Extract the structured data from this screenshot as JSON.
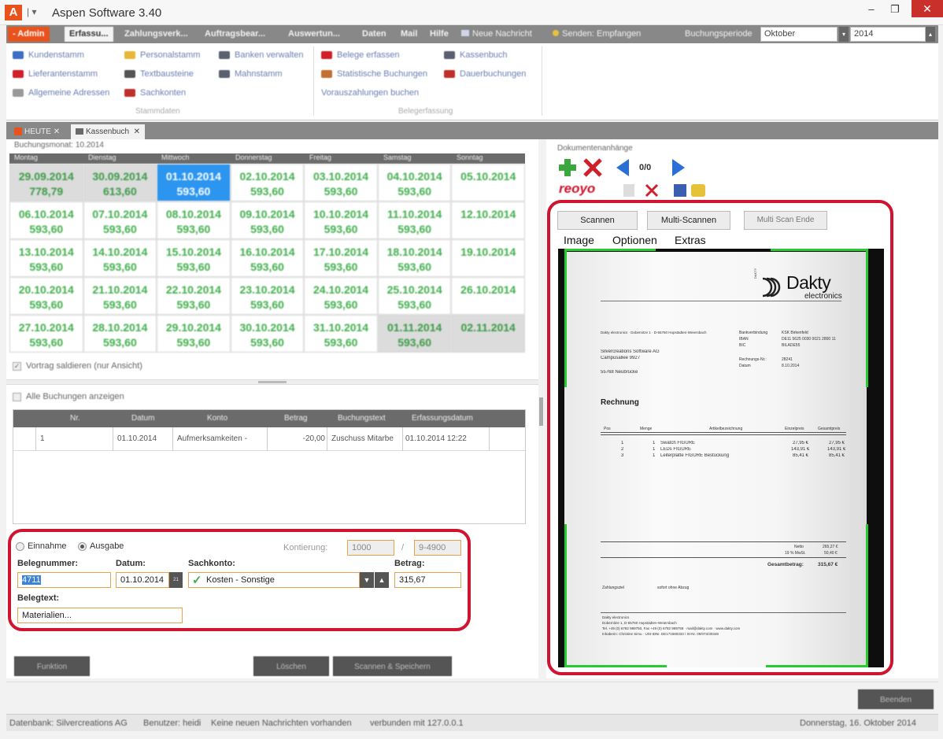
{
  "app": {
    "logo_letter": "A",
    "qat": "|  ▾",
    "title": "Aspen Software 3.40",
    "minimize": "–",
    "restore": "❐",
    "close": "✕"
  },
  "menu": {
    "items": [
      "- Admin",
      "Erfassu...",
      "Zahlungsverk...",
      "Auftragsbear...",
      "Auswertun...",
      "Daten",
      "Mail",
      "Hilfe"
    ],
    "new_message": "Neue Nachricht",
    "send": "Senden: Empfangen",
    "period_label": "Buchungsperiode",
    "month": "Oktober",
    "year": "2014"
  },
  "ribbon": {
    "col1": [
      "Kundenstamm",
      "Lieferantenstamm",
      "Allgemeine Adressen"
    ],
    "col2": [
      "Personalstamm",
      "Textbausteine",
      "Sachkonten"
    ],
    "col3": [
      "Banken verwalten",
      "Mahnstamm"
    ],
    "group1": "Stammdaten",
    "col4": [
      "Belege erfassen",
      "Statistische Buchungen",
      "Vorauszahlungen buchen"
    ],
    "col5": [
      "Kassenbuch",
      "Dauerbuchungen"
    ],
    "group2": "Belegerfassung",
    "icon_colors": [
      "#3a6fc4",
      "#d0202a",
      "#999999",
      "#e6b83a",
      "#555555",
      "#c0302a",
      "#5a6070",
      "#3a5fa0",
      "#d0202a",
      "#c07030",
      "#5a6070",
      "#c0302a"
    ]
  },
  "tabs": {
    "heute": "HEUTE",
    "kassenbuch": "Kassenbuch"
  },
  "calendar": {
    "month_label": "Buchungsmonat: 10.2014",
    "days": [
      "Montag",
      "Dienstag",
      "Mittwoch",
      "Donnerstag",
      "Freitag",
      "Samstag",
      "Sonntag"
    ],
    "cells": [
      {
        "d": "29.09.2014",
        "v": "778,79",
        "s": "gray"
      },
      {
        "d": "30.09.2014",
        "v": "613,60",
        "s": "gray"
      },
      {
        "d": "01.10.2014",
        "v": "593,60",
        "s": "today"
      },
      {
        "d": "02.10.2014",
        "v": "593,60",
        "s": ""
      },
      {
        "d": "03.10.2014",
        "v": "593,60",
        "s": ""
      },
      {
        "d": "04.10.2014",
        "v": "593,60",
        "s": ""
      },
      {
        "d": "05.10.2014",
        "v": "",
        "s": ""
      },
      {
        "d": "06.10.2014",
        "v": "593,60",
        "s": ""
      },
      {
        "d": "07.10.2014",
        "v": "593,60",
        "s": ""
      },
      {
        "d": "08.10.2014",
        "v": "593,60",
        "s": ""
      },
      {
        "d": "09.10.2014",
        "v": "593,60",
        "s": ""
      },
      {
        "d": "10.10.2014",
        "v": "593,60",
        "s": ""
      },
      {
        "d": "11.10.2014",
        "v": "593,60",
        "s": ""
      },
      {
        "d": "12.10.2014",
        "v": "",
        "s": ""
      },
      {
        "d": "13.10.2014",
        "v": "593,60",
        "s": ""
      },
      {
        "d": "14.10.2014",
        "v": "593,60",
        "s": ""
      },
      {
        "d": "15.10.2014",
        "v": "593,60",
        "s": ""
      },
      {
        "d": "16.10.2014",
        "v": "593,60",
        "s": ""
      },
      {
        "d": "17.10.2014",
        "v": "593,60",
        "s": ""
      },
      {
        "d": "18.10.2014",
        "v": "593,60",
        "s": ""
      },
      {
        "d": "19.10.2014",
        "v": "",
        "s": ""
      },
      {
        "d": "20.10.2014",
        "v": "593,60",
        "s": ""
      },
      {
        "d": "21.10.2014",
        "v": "593,60",
        "s": ""
      },
      {
        "d": "22.10.2014",
        "v": "593,60",
        "s": ""
      },
      {
        "d": "23.10.2014",
        "v": "593,60",
        "s": ""
      },
      {
        "d": "24.10.2014",
        "v": "593,60",
        "s": ""
      },
      {
        "d": "25.10.2014",
        "v": "593,60",
        "s": ""
      },
      {
        "d": "26.10.2014",
        "v": "",
        "s": ""
      },
      {
        "d": "27.10.2014",
        "v": "593,60",
        "s": ""
      },
      {
        "d": "28.10.2014",
        "v": "593,60",
        "s": ""
      },
      {
        "d": "29.10.2014",
        "v": "593,60",
        "s": ""
      },
      {
        "d": "30.10.2014",
        "v": "593,60",
        "s": ""
      },
      {
        "d": "31.10.2014",
        "v": "593,60",
        "s": ""
      },
      {
        "d": "01.11.2014",
        "v": "593,60",
        "s": "gray"
      },
      {
        "d": "02.11.2014",
        "v": "",
        "s": "gray"
      }
    ]
  },
  "vortrag": "Vortrag saldieren (nur Ansicht)",
  "alle_buchungen": "Alle Buchungen anzeigen",
  "bookings": {
    "headers": [
      "Nr.",
      "Datum",
      "Konto",
      "Betrag",
      "Buchungstext",
      "Erfassungsdatum"
    ],
    "rows": [
      [
        "1",
        "01.10.2014",
        "Aufmerksamkeiten - ",
        "-20,00",
        "Zuschuss Mitarbe",
        "01.10.2014 12:22"
      ]
    ]
  },
  "form": {
    "einnahme": "Einnahme",
    "ausgabe": "Ausgabe",
    "kontierung_label": "Kontierung:",
    "kontierung_a": "1000",
    "kontierung_sep": "/",
    "kontierung_b": "9-4900",
    "belegnummer_label": "Belegnummer:",
    "belegnummer": "4711",
    "datum_label": "Datum:",
    "datum": "01.10.2014",
    "datum_btn": "21",
    "sachkonto_label": "Sachkonto:",
    "sachkonto": "Kosten - Sonstige",
    "betrag_label": "Betrag:",
    "betrag": "315,67",
    "belegtext_label": "Belegtext:",
    "belegtext": "Materialien..."
  },
  "buttons": {
    "funktion": "Funktion",
    "loeschen": "Löschen",
    "scannen_speichern": "Scannen & Speichern",
    "beenden": "Beenden"
  },
  "attachments": {
    "title": "Dokumentenanhänge",
    "counter": "0/0",
    "brand": "reoyo"
  },
  "scanner": {
    "scannen": "Scannen",
    "multi": "Multi-Scannen",
    "multi_end": "Multi Scan Ende",
    "menu": [
      "Image",
      "Optionen",
      "Extras"
    ]
  },
  "invoice": {
    "brand": "Dakty",
    "brand_sub": "electronics",
    "brand_vert": "DAKTY",
    "sender": "Dakty electronics · Dobernitze 1 · D-55760 Hopstädten-Weiersbach",
    "bank_labels": [
      "Bankverbindung",
      "IBAN",
      "BIC"
    ],
    "bank_values": [
      "KSK Birkenfeld",
      "DE11 5625 0030 0021 2800 11",
      "BILADE55"
    ],
    "recipient": [
      "Silvercreations Software AG",
      "Campusallee 9927",
      "",
      "55768     Neubrücke"
    ],
    "meta_labels": [
      "Rechnungs-Nr.:",
      "Datum"
    ],
    "meta_values": [
      "28241",
      "8.10.2014"
    ],
    "heading": "Rechnung",
    "columns": [
      "Pos",
      "Menge",
      "Artikelbezeichnung",
      "Einzelpreis",
      "Gesamtpreis"
    ],
    "lines": [
      [
        "1",
        "1",
        "Swatch FIGURE",
        "27,95 €",
        "27,95 €"
      ],
      [
        "2",
        "1",
        "LEDs FIGURE",
        "143,91 €",
        "143,91 €"
      ],
      [
        "3",
        "1",
        "Leiterplatte FIGURE Bestückung",
        "85,41 €",
        "85,41 €"
      ]
    ],
    "netto_label": "Netto",
    "netto": "265,27 €",
    "mwst_label": "19 % MwSt.",
    "mwst": "50,40 €",
    "total_label": "Gesamtbetrag:",
    "total": "315,67 €",
    "zahlungsziel_label": "Zahlungsziel",
    "zahlungsziel": "sofort ohne Abzug",
    "footer": [
      "Dakty electronics",
      "Dobernitze 1,    D-55760 Hopstädten-Weiersbach",
      "Tel. +49 (0) 6782 989750, Fax +49 (0) 6782 989758 · mail@dakty.com · www.dakty.com",
      "Inhaberin: Christine Simu · USt-IDNr. DE171580333 / St-Nr. 09/073/30349"
    ]
  },
  "status": {
    "db": "Datenbank: Silvercreations AG",
    "user": "Benutzer: heidi",
    "messages": "Keine neuen Nachrichten vorhanden",
    "connection": "verbunden mit 127.0.0.1",
    "date": "Donnerstag, 16. Oktober 2014"
  },
  "colors": {
    "accent": "#e8531d",
    "highlight": "#d0132e",
    "today": "#2b95f0",
    "amount_green": "#3fae4b",
    "scan_border": "#29c930"
  }
}
